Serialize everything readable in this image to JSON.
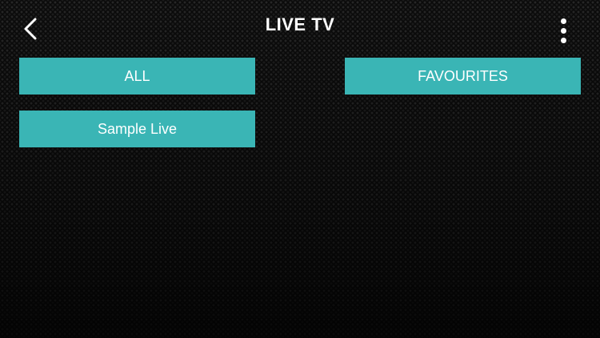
{
  "header": {
    "title": "LIVE TV",
    "back_icon": "chevron-left-icon",
    "menu_icon": "more-vertical-icon"
  },
  "categories": [
    {
      "label": "ALL"
    },
    {
      "label": "FAVOURITES"
    },
    {
      "label": "Sample Live"
    }
  ],
  "colors": {
    "tile": "#3ab5b5",
    "background": "#0b0b0b",
    "text": "#ffffff"
  }
}
